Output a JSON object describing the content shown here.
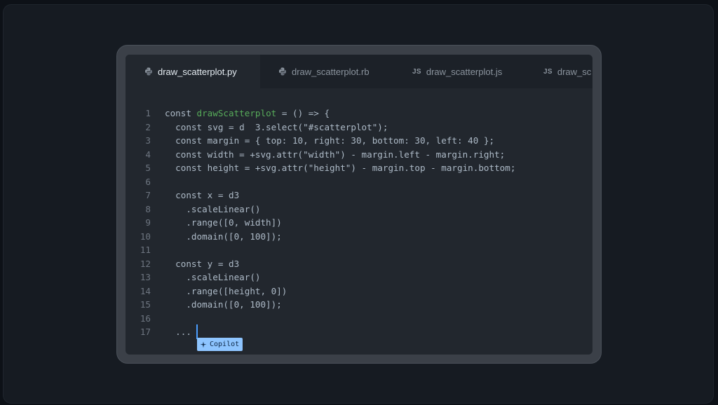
{
  "tabs": [
    {
      "label": "draw_scatterplot.py",
      "icon": "python-icon",
      "active": true
    },
    {
      "label": "draw_scatterplot.rb",
      "icon": "ruby-icon",
      "active": false
    },
    {
      "label": "draw_scatterplot.js",
      "icon": "js-icon",
      "icon_text": "JS",
      "active": false
    },
    {
      "label": "draw_sc",
      "icon": "js-icon",
      "icon_text": "JS",
      "active": false
    }
  ],
  "code": {
    "lines": [
      {
        "num": "1",
        "pre": "const ",
        "fn": "drawScatterplot",
        "post": " = () => {"
      },
      {
        "num": "2",
        "text": "  const svg = d  3.select(\"#scatterplot\");"
      },
      {
        "num": "3",
        "text": "  const margin = { top: 10, right: 30, bottom: 30, left: 40 };"
      },
      {
        "num": "4",
        "text": "  const width = +svg.attr(\"width\") - margin.left - margin.right;"
      },
      {
        "num": "5",
        "text": "  const height = +svg.attr(\"height\") - margin.top - margin.bottom;"
      },
      {
        "num": "6",
        "text": ""
      },
      {
        "num": "7",
        "text": "  const x = d3"
      },
      {
        "num": "8",
        "text": "    .scaleLinear()"
      },
      {
        "num": "9",
        "text": "    .range([0, width])"
      },
      {
        "num": "10",
        "text": "    .domain([0, 100]);"
      },
      {
        "num": "11",
        "text": ""
      },
      {
        "num": "12",
        "text": "  const y = d3"
      },
      {
        "num": "13",
        "text": "    .scaleLinear()"
      },
      {
        "num": "14",
        "text": "    .range([height, 0])"
      },
      {
        "num": "15",
        "text": "    .domain([0, 100]);"
      },
      {
        "num": "16",
        "text": ""
      },
      {
        "num": "17",
        "text": "  ..."
      }
    ]
  },
  "copilot": {
    "label": "Copilot",
    "icon": "copilot-icon"
  },
  "colors": {
    "background": "#0d1117",
    "editor": "#22272e",
    "function_name": "#57ab5a",
    "cursor": "#4a9eff",
    "copilot_badge": "#8ec5ff"
  }
}
